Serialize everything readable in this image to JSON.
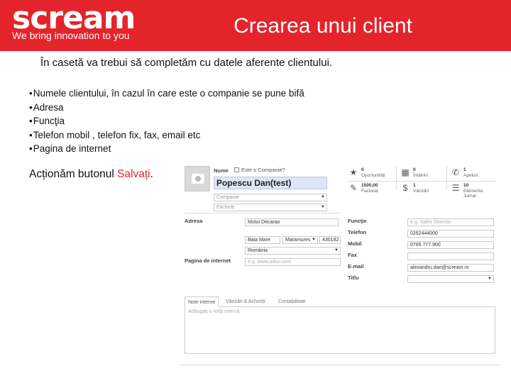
{
  "header": {
    "logo": "scream",
    "tagline": "We bring innovation to you",
    "title": "Crearea unui client",
    "colors": {
      "brand": "#e3242b",
      "text": "#ffffff"
    }
  },
  "intro": "În casetă va trebui să completăm cu datele aferente clientului.",
  "bullets": [
    "Numele clientului, în cazul în care este o companie se pune bifă",
    "Adresa",
    "Funcţia",
    "Telefon mobil , telefon fix, fax, email etc",
    "Pagina de internet"
  ],
  "action": {
    "before": "Acționăm butonul ",
    "highlight": "Salvați",
    "after": "."
  },
  "form": {
    "name_label": "Nume",
    "is_company_label": "Este o Companie?",
    "name_value": "Popescu Dan(test)",
    "company_placeholder": "Companie",
    "tags_placeholder": "Etichete",
    "address_label": "Adresa",
    "street": "Motoi Decarao",
    "city": "Baia Mare",
    "state": "Maramures",
    "zip": "430182",
    "country": "România",
    "website_label": "Pagina de internet",
    "website_placeholder": "e.g. www.odoo.com",
    "function_label": "Funcţie",
    "function_placeholder": "e.g. Sales Director",
    "phone_label": "Telefon",
    "phone_value": "0262444000",
    "mobile_label": "Mobil",
    "mobile_value": "0765.777.900",
    "fax_label": "Fax",
    "email_label": "E-mail",
    "email_value": "alexandru.dan@scream.ro",
    "title_label": "Titlu"
  },
  "smart_buttons": [
    {
      "icon": "star-icon",
      "glyph": "★",
      "num": "0",
      "text": "Oportunități"
    },
    {
      "icon": "calendar-icon",
      "glyph": "▦",
      "num": "0",
      "text": "Întâlniri"
    },
    {
      "icon": "phone-icon",
      "glyph": "✆",
      "num": "1",
      "text": "Apeluri"
    },
    {
      "icon": "invoice-icon",
      "glyph": "✎",
      "num": "1500,00",
      "text": "Facturat"
    },
    {
      "icon": "dollar-icon",
      "glyph": "$",
      "num": "1",
      "text": "Vânzări"
    },
    {
      "icon": "list-icon",
      "glyph": "☰",
      "num": "10",
      "text": "Elemente Jurnal"
    }
  ],
  "tabs": [
    "Note interne",
    "Vânzări & Achiziții",
    "Contabilitate"
  ],
  "notes_placeholder": "Adăugați o notă internă"
}
